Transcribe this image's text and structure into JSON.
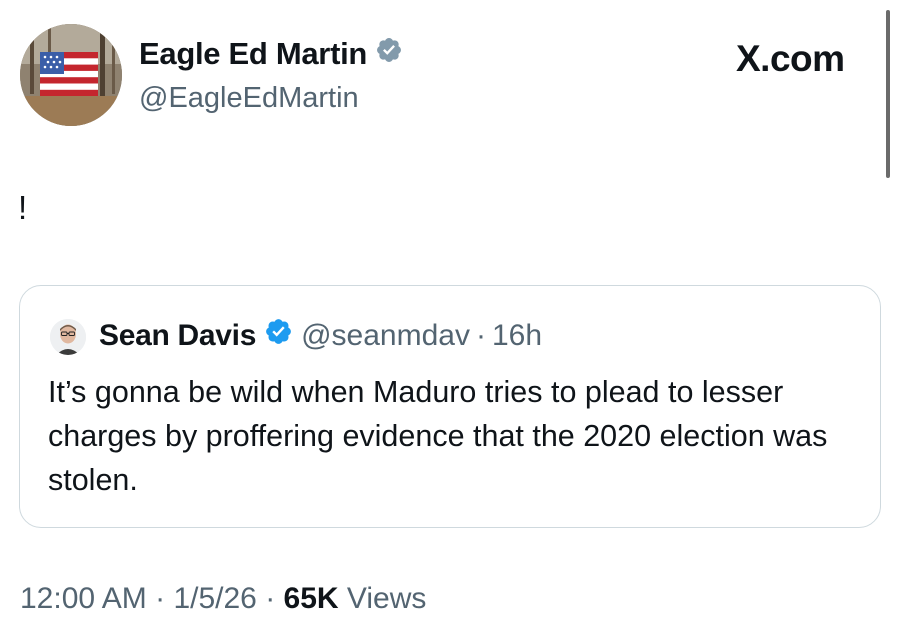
{
  "author": {
    "name": "Eagle Ed Martin",
    "handle": "@EagleEdMartin"
  },
  "site_brand": "X.com",
  "tweet": {
    "text": "!"
  },
  "quoted_tweet": {
    "name": "Sean Davis",
    "handle": "@seanmdav",
    "separator": "·",
    "time": "16h",
    "text": "It’s gonna be wild when Maduro tries to plead to lesser charges by proffering evidence that the 2020 election was stolen."
  },
  "meta": {
    "time": "12:00 AM",
    "sep1": " · ",
    "date": "1/5/26",
    "sep2": " · ",
    "views_count": "65K",
    "views_label": " Views"
  },
  "colors": {
    "text_primary": "#0f1419",
    "text_secondary": "#536471",
    "verified_blue": "#1d9bf0",
    "card_border": "#cfd9de"
  },
  "icons": {
    "author_verified": "verified-badge-icon",
    "quote_verified": "verified-badge-icon"
  }
}
